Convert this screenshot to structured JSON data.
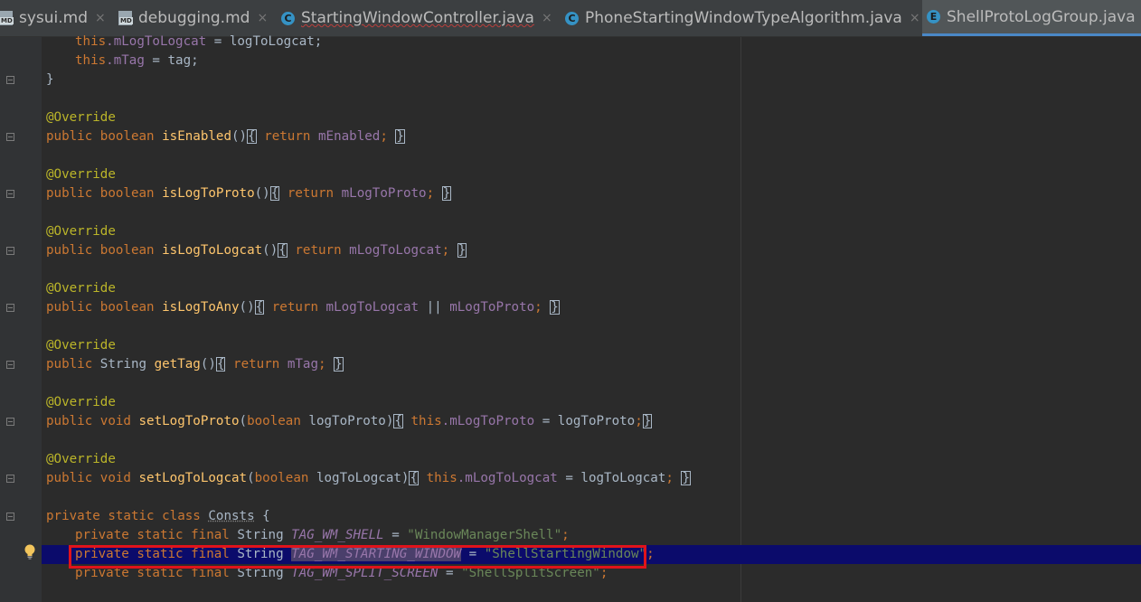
{
  "tabs": [
    {
      "label": "sysui.md",
      "icon": "markdown-file-icon",
      "active": false
    },
    {
      "label": "debugging.md",
      "icon": "markdown-file-icon",
      "active": false
    },
    {
      "label": "StartingWindowController.java",
      "icon": "java-class-icon",
      "active": false
    },
    {
      "label": "PhoneStartingWindowTypeAlgorithm.java",
      "icon": "java-class-icon",
      "active": false
    },
    {
      "label": "ShellProtoLogGroup.java",
      "icon": "java-enum-icon",
      "active": true
    }
  ],
  "icons": {
    "md_badge": "MD",
    "class_letter": "C",
    "enum_letter": "E",
    "close": "×"
  },
  "code": {
    "l1": {
      "kw": "this",
      "field": ".mLogToLogcat",
      "rest": " = logToLogcat;"
    },
    "l2": {
      "kw": "this",
      "field": ".mTag",
      "rest": " = tag;"
    },
    "l3": "}",
    "override": "@Override",
    "isEnabled": {
      "kw": "public boolean ",
      "fn": "isEnabled",
      "sig": "()",
      "ret": "return ",
      "val": "mEnabled",
      "semi": ";",
      "ob": "{",
      "cb": "}"
    },
    "isLogToProto": {
      "kw": "public boolean ",
      "fn": "isLogToProto",
      "sig": "()",
      "ret": "return ",
      "val": "mLogToProto",
      "semi": ";",
      "ob": "{",
      "cb": "}"
    },
    "isLogToLogcat": {
      "kw": "public boolean ",
      "fn": "isLogToLogcat",
      "sig": "()",
      "ret": "return ",
      "val": "mLogToLogcat",
      "semi": ";",
      "ob": "{",
      "cb": "}"
    },
    "isLogToAny": {
      "kw": "public boolean ",
      "fn": "isLogToAny",
      "sig": "()",
      "ret": "return ",
      "val1": "mLogToLogcat",
      "op": " || ",
      "val2": "mLogToProto",
      "semi": ";",
      "ob": "{",
      "cb": "}"
    },
    "getTag": {
      "kw": "public ",
      "type": "String ",
      "fn": "getTag",
      "sig": "()",
      "ret": "return ",
      "val": "mTag",
      "semi": ";",
      "ob": "{",
      "cb": "}"
    },
    "setLogToProto": {
      "kw": "public void ",
      "fn": "setLogToProto",
      "p1": "(",
      "ptype": "boolean",
      "pname": " logToProto)",
      "this": "this",
      "field": ".mLogToProto",
      "rest": " = logToProto",
      "semi": ";",
      "ob": "{",
      "cb": "}"
    },
    "setLogToLogcat": {
      "kw": "public void ",
      "fn": "setLogToLogcat",
      "p1": "(",
      "ptype": "boolean",
      "pname": " logToLogcat)",
      "this": "this",
      "field": ".mLogToLogcat",
      "rest": " = logToLogcat",
      "semi": ";",
      "ob": "{",
      "cb": "}"
    },
    "consts": {
      "kw": "private static class ",
      "name": "Consts",
      "rest": " {"
    },
    "c1": {
      "kw": "private static final ",
      "type": "String ",
      "name": "TAG_WM_SHELL",
      "eq": " = ",
      "str": "\"WindowManagerShell\"",
      "semi": ";"
    },
    "c2": {
      "kw": "private static final ",
      "type": "String ",
      "name": "TAG_WM_STARTING_WINDOW",
      "eq": " = ",
      "str": "\"ShellStartingWindow\"",
      "semi": ";"
    },
    "c3": {
      "kw": "private static final ",
      "type": "String ",
      "name": "TAG_WM_SPLIT_SCREEN",
      "eq": " = ",
      "str": "\"ShellSplitScreen\"",
      "semi": ";"
    }
  },
  "colors": {
    "selection_line": "#0b0b6b",
    "highlight_box": "#e0131b",
    "active_tab_underline": "#4a88c7"
  }
}
